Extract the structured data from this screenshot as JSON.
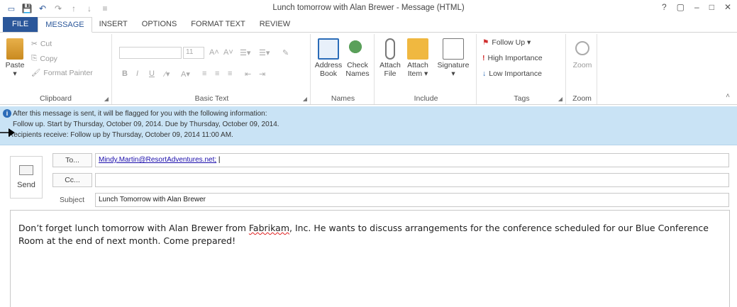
{
  "window": {
    "title": "Lunch tomorrow with Alan Brewer - Message (HTML)",
    "controls": [
      "?",
      "▢",
      "–",
      "□",
      "✕"
    ]
  },
  "tabs": [
    "FILE",
    "MESSAGE",
    "INSERT",
    "OPTIONS",
    "FORMAT TEXT",
    "REVIEW"
  ],
  "active_tab": "MESSAGE",
  "ribbon": {
    "clipboard": {
      "label": "Clipboard",
      "paste": "Paste",
      "cut": "Cut",
      "copy": "Copy",
      "format_painter": "Format Painter"
    },
    "basic_text": {
      "label": "Basic Text",
      "font_size": "11",
      "bold": "B",
      "italic": "I",
      "underline": "U"
    },
    "names": {
      "label": "Names",
      "address_book": [
        "Address",
        "Book"
      ],
      "check_names": [
        "Check",
        "Names"
      ]
    },
    "include": {
      "label": "Include",
      "attach_file": [
        "Attach",
        "File"
      ],
      "attach_item": [
        "Attach",
        "Item ▾"
      ],
      "signature": [
        "Signature",
        "▾"
      ]
    },
    "tags": {
      "label": "Tags",
      "follow_up": "Follow Up ▾",
      "high": "High Importance",
      "low": "Low Importance"
    },
    "zoom": {
      "label": "Zoom",
      "zoom": "Zoom"
    }
  },
  "infobar": {
    "line1": "After this message is sent, it will be flagged for you with the following information:",
    "line2": "Follow up.  Start by Thursday, October 09, 2014.  Due by Thursday, October 09, 2014.",
    "line3": "Recipients receive: Follow up by Thursday, October 09, 2014 11:00 AM."
  },
  "compose": {
    "send": "Send",
    "to_button": "To...",
    "cc_button": "Cc...",
    "subject_label": "Subject",
    "to_value": "Mindy.Martin@ResortAdventures.net;",
    "cc_value": "",
    "subject_value": "Lunch Tomorrow with Alan Brewer",
    "body_before": "Don’t forget lunch tomorrow with Alan Brewer from ",
    "body_misspelled": "Fabrikam",
    "body_after": ", Inc. He wants to discuss arrangements for the conference scheduled for our Blue Conference Room at the end of next month. Come prepared!"
  },
  "colors": {
    "accent": "#2b579a",
    "infobar": "#c9e3f5",
    "link": "#1a0dab"
  }
}
